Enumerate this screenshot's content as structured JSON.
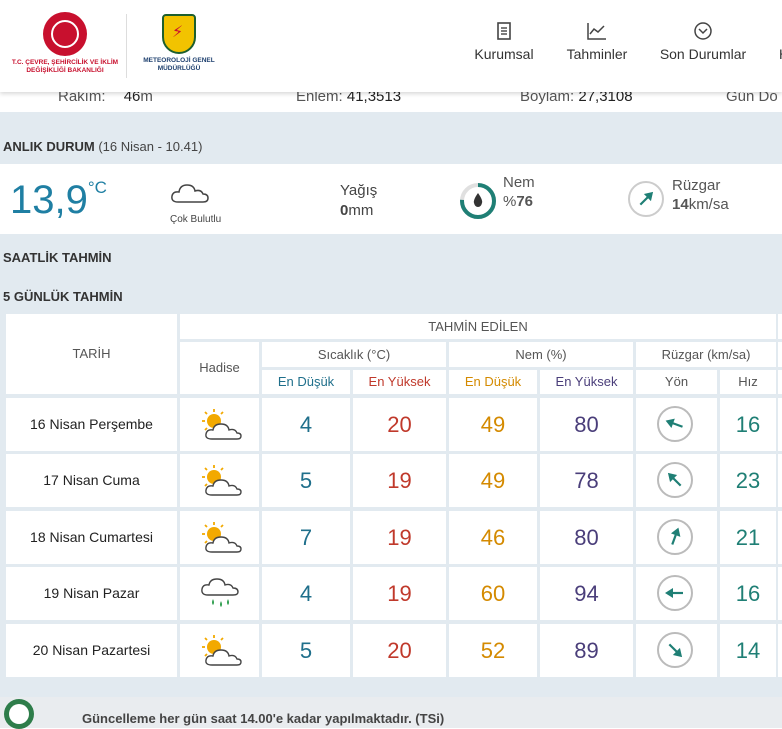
{
  "header": {
    "ministry_logo_text": "T.C. ÇEVRE, ŞEHİRCİLİK VE İKLİM DEĞİŞİKLİĞİ BAKANLIĞI",
    "met_logo_text": "METEOROLOJİ GENEL MÜDÜRLÜĞÜ",
    "nav": [
      {
        "label": "Kurumsal",
        "icon": "document-icon"
      },
      {
        "label": "Tahminler",
        "icon": "chart-icon"
      },
      {
        "label": "Son Durumlar",
        "icon": "chevron-circle-icon"
      },
      {
        "label": "H",
        "icon": ""
      }
    ]
  },
  "location": {
    "rakim_label": "Rakım:",
    "rakim_value": "46",
    "rakim_unit": "m",
    "enlem_label": "Enlem:",
    "enlem_value": "41,3513",
    "boylam_label": "Boylam:",
    "boylam_value": "27,3108",
    "gun_label": "Gün Do"
  },
  "current": {
    "section_title": "ANLIK DURUM",
    "section_time": "(16 Nisan - 10.41)",
    "temperature": "13,9",
    "temp_unit": "°C",
    "condition": "Çok Bulutlu",
    "precip_label": "Yağış",
    "precip_value": "0",
    "precip_unit": "mm",
    "humidity_label": "Nem",
    "humidity_prefix": "%",
    "humidity_value": "76",
    "humidity_fraction": 0.76,
    "wind_label": "Rüzgar",
    "wind_value": "14",
    "wind_unit": "km/sa"
  },
  "sections": {
    "hourly": "SAATLİK TAHMİN",
    "five_day": "5 GÜNLÜK TAHMİN"
  },
  "forecast": {
    "headers": {
      "tarih": "TARİH",
      "predicted": "TAHMİN EDİLEN",
      "hadise": "Hadise",
      "sicaklik": "Sıcaklık (°C)",
      "nem": "Nem (%)",
      "ruzgar": "Rüzgar (km/sa)",
      "en_dusuk": "En Düşük",
      "en_yuksek": "En Yüksek",
      "yon": "Yön",
      "hiz": "Hız"
    },
    "rows": [
      {
        "date": "16 Nisan Perşembe",
        "icon": "partly-cloudy-icon",
        "t_lo": "4",
        "t_hi": "20",
        "h_lo": "49",
        "h_hi": "80",
        "wind_dir_deg": 110,
        "speed": "16"
      },
      {
        "date": "17 Nisan Cuma",
        "icon": "partly-cloudy-icon",
        "t_lo": "5",
        "t_hi": "19",
        "h_lo": "49",
        "h_hi": "78",
        "wind_dir_deg": 135,
        "speed": "23"
      },
      {
        "date": "18 Nisan Cumartesi",
        "icon": "partly-cloudy-icon",
        "t_lo": "7",
        "t_hi": "19",
        "h_lo": "46",
        "h_hi": "80",
        "wind_dir_deg": 200,
        "speed": "21"
      },
      {
        "date": "19 Nisan Pazar",
        "icon": "rain-cloud-icon",
        "t_lo": "4",
        "t_hi": "19",
        "h_lo": "60",
        "h_hi": "94",
        "wind_dir_deg": 90,
        "speed": "16"
      },
      {
        "date": "20 Nisan Pazartesi",
        "icon": "partly-cloudy-icon",
        "t_lo": "5",
        "t_hi": "20",
        "h_lo": "52",
        "h_hi": "89",
        "wind_dir_deg": 315,
        "speed": "14"
      }
    ]
  },
  "footer": {
    "note": "Güncelleme her gün saat 14.00'e kadar yapılmaktadır. (TSi)"
  },
  "colors": {
    "accent": "#1f7fa3",
    "temp_low": "#1f6f8b",
    "temp_high": "#c0392b",
    "hum_low": "#d48a00",
    "hum_high": "#4a3e7a",
    "speed": "#1f7f75"
  }
}
